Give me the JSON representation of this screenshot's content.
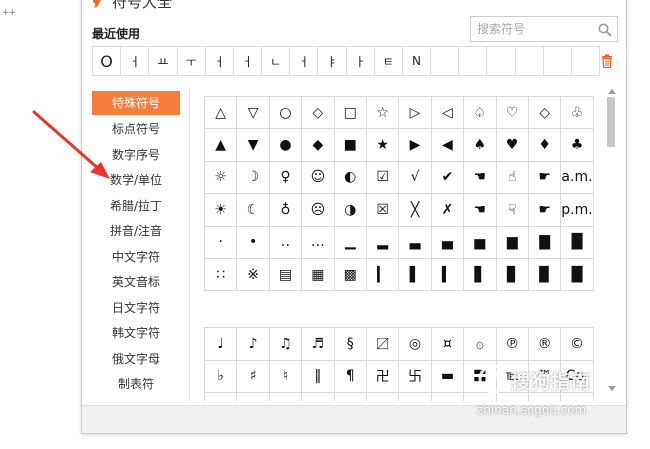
{
  "background": {
    "corner_mark": "++"
  },
  "dialog": {
    "title": "符号大全",
    "accent_color": "#f5803e",
    "recent": {
      "label": "最近使用",
      "symbols": [
        "O",
        "ㅓ",
        "ㅛ",
        "ㅜ",
        "ㅓ",
        "ㅓ",
        "ㄴ",
        "ㅓ",
        "ㅑ",
        "ㅏ",
        "ㅌ",
        "N",
        "",
        "",
        "",
        "",
        "",
        ""
      ]
    },
    "search": {
      "placeholder": "搜索符号"
    },
    "sidebar": {
      "items": [
        {
          "label": "特殊符号",
          "active": true
        },
        {
          "label": "标点符号"
        },
        {
          "label": "数字序号"
        },
        {
          "label": "数学/单位"
        },
        {
          "label": "希腊/拉丁"
        },
        {
          "label": "拼音/注音"
        },
        {
          "label": "中文字符"
        },
        {
          "label": "英文音标"
        },
        {
          "label": "日文字符"
        },
        {
          "label": "韩文字符"
        },
        {
          "label": "俄文字母"
        },
        {
          "label": "制表符"
        }
      ]
    },
    "grid_a": [
      "△",
      "▽",
      "○",
      "◇",
      "□",
      "☆",
      "▷",
      "◁",
      "♤",
      "♡",
      "◇",
      "♧",
      "▲",
      "▼",
      "●",
      "◆",
      "■",
      "★",
      "▶",
      "◀",
      "♠",
      "♥",
      "♦",
      "♣",
      "☼",
      "☽",
      "♀",
      "☺",
      "◐",
      "☑",
      "√",
      "✔",
      "☚",
      "☝",
      "☛",
      "a.m.",
      "☀",
      "☾",
      "♁",
      "☹",
      "◑",
      "☒",
      "╳",
      "✗",
      "☚",
      "☟",
      "☛",
      "p.m.",
      "·",
      "•",
      "‥",
      "…",
      "▁",
      "▂",
      "▃",
      "▄",
      "▅",
      "▆",
      "▇",
      "█",
      "∷",
      "※",
      "▤",
      "▦",
      "▩",
      "▎",
      "▌",
      "▍",
      "▋",
      "▊",
      "▉",
      "█"
    ],
    "grid_b": [
      "♩",
      "♪",
      "♫",
      "♬",
      "§",
      "〼",
      "◎",
      "¤",
      "۞",
      "℗",
      "®",
      "©",
      "♭",
      "♯",
      "♮",
      "‖",
      "¶",
      "卍",
      "卐",
      "▬",
      "〓",
      "℡",
      "™",
      "Co.",
      "",
      "",
      "",
      "",
      "",
      "",
      "",
      "",
      "",
      "",
      "",
      ""
    ]
  },
  "watermark": {
    "brand": "搜狗指南",
    "url": "zhinan.sogou.com"
  }
}
